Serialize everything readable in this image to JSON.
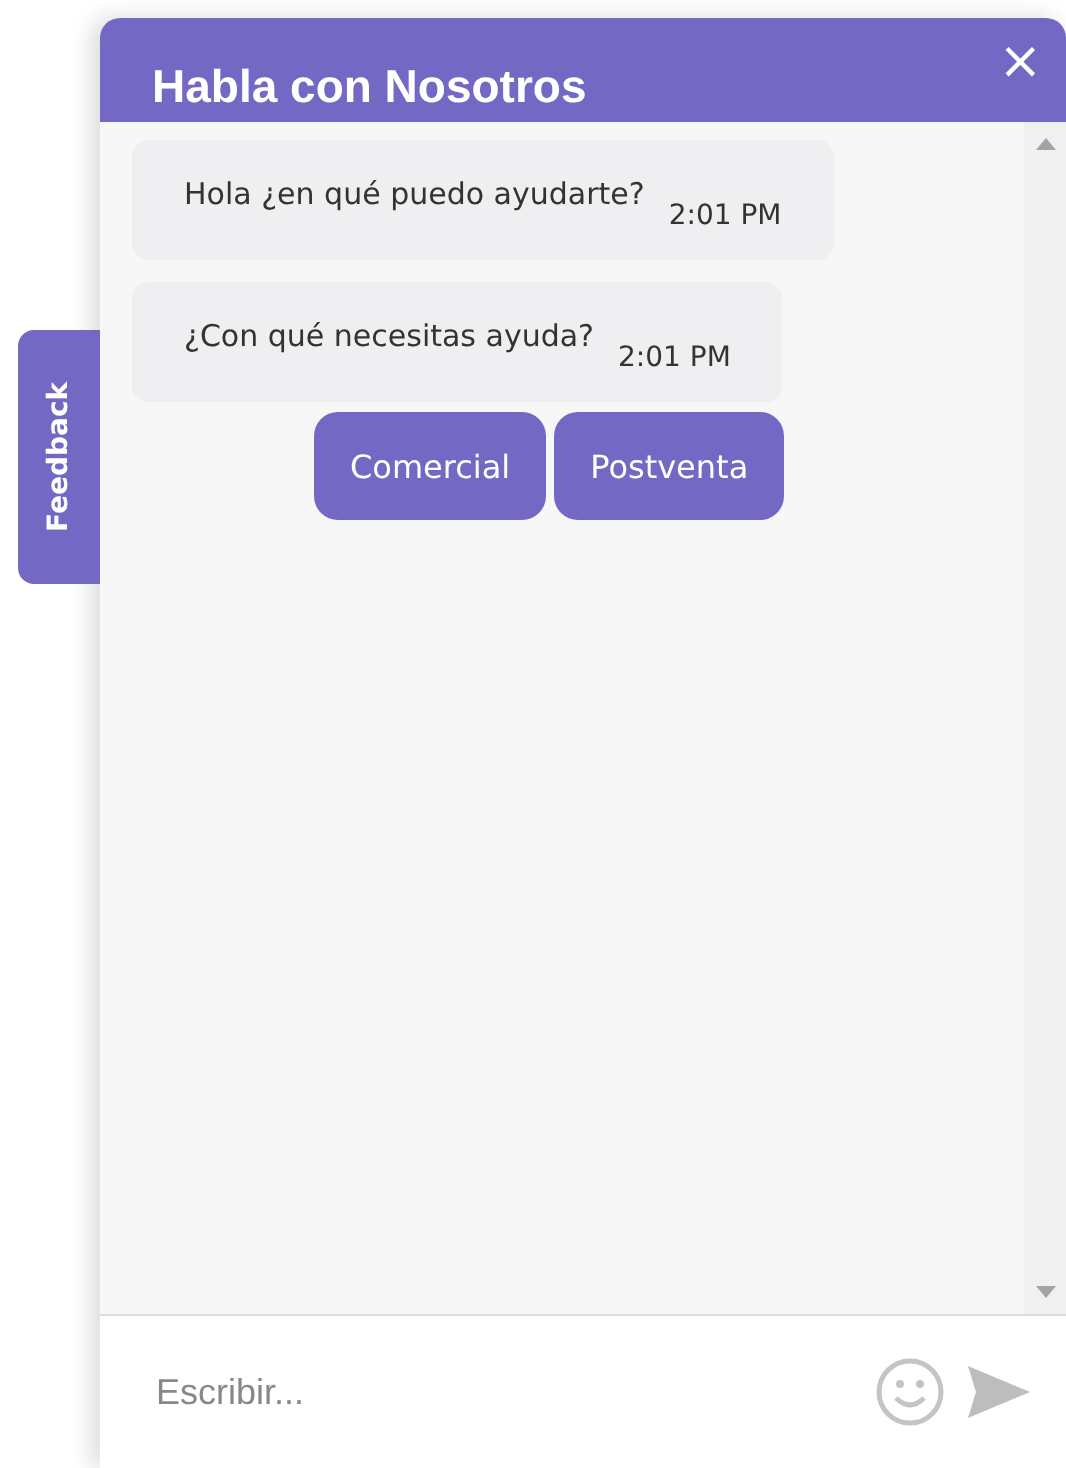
{
  "feedback_tab": {
    "label": "Feedback"
  },
  "chat": {
    "title": "Habla con Nosotros",
    "close": "×",
    "messages": [
      {
        "text": "Hola ¿en qué puedo ayudarte?",
        "time": "2:01 PM"
      },
      {
        "text": "¿Con qué necesitas ayuda?",
        "time": "2:01 PM"
      }
    ],
    "quick_replies": [
      "Comercial",
      "Postventa"
    ],
    "input": {
      "placeholder": "Escribir..."
    }
  }
}
